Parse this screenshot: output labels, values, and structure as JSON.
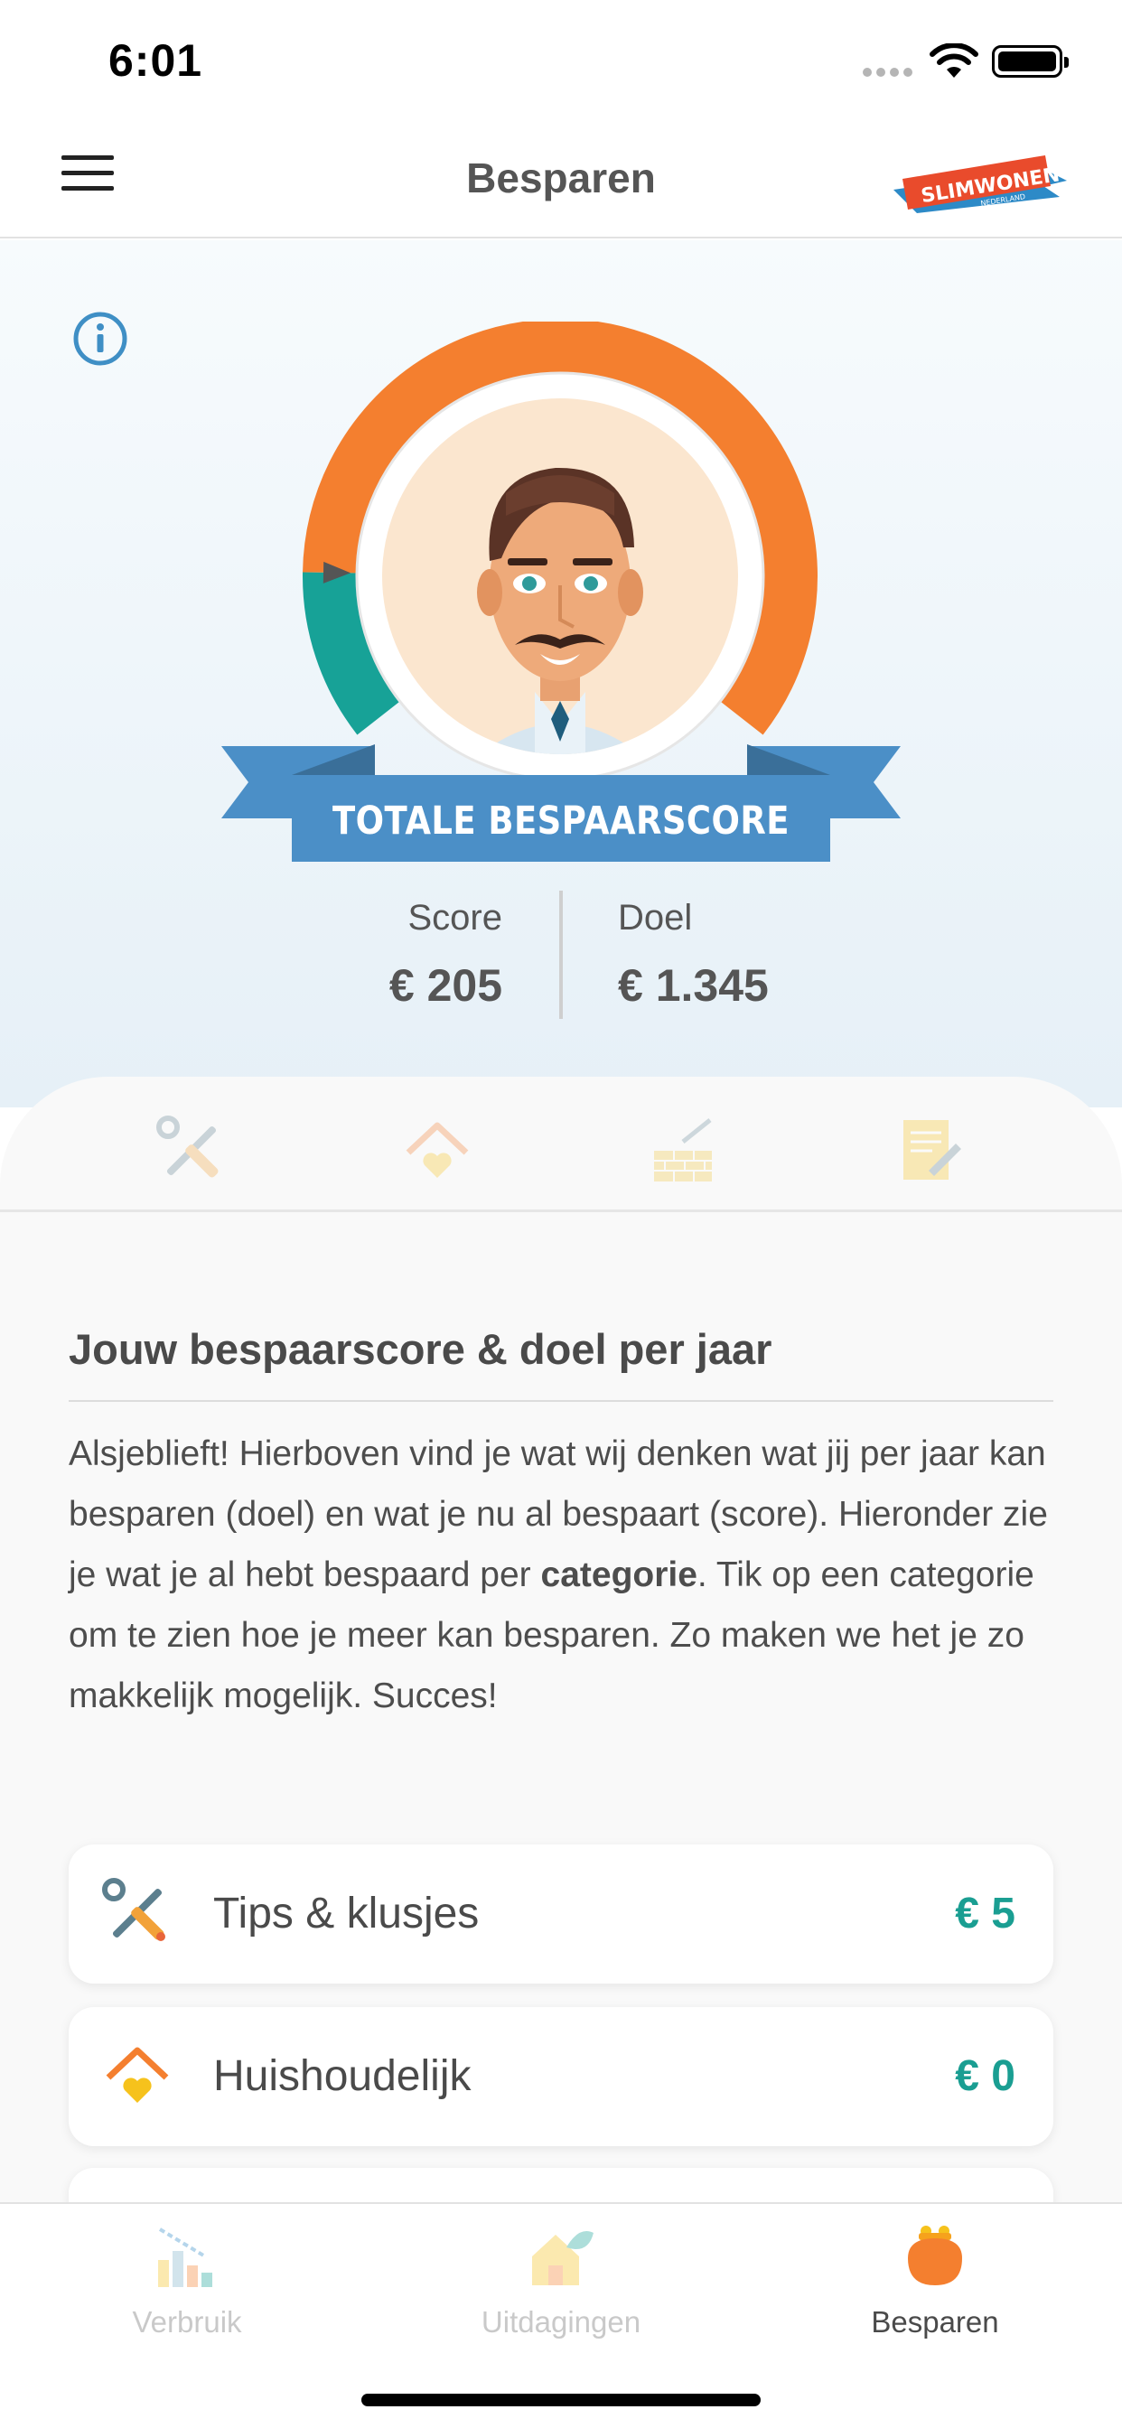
{
  "status_bar": {
    "time": "6:01"
  },
  "nav": {
    "title": "Besparen",
    "logo_text": "SLIMWONEN",
    "logo_subtext": "NEDERLAND"
  },
  "hero": {
    "ribbon_text": "TOTALE BESPAARSCORE",
    "score_label": "Score",
    "score_value": "€ 205",
    "goal_label": "Doel",
    "goal_value": "€ 1.345",
    "progress_fraction": 0.152
  },
  "category_tabs": [
    "tools-icon",
    "house-heart-icon",
    "bricks-icon",
    "document-pen-icon"
  ],
  "section": {
    "title": "Jouw bespaarscore & doel per jaar",
    "text_before_bold": "Alsjeblieft! Hierboven vind je wat wij denken wat jij per jaar kan besparen (doel) en wat je nu al bespaart (score). Hieronder zie je wat je al hebt bespaard per ",
    "text_bold": "categorie",
    "text_after_bold": ". Tik op een categorie om te zien hoe je meer kan besparen. Zo maken we het je zo makkelijk mogelijk. Succes!"
  },
  "categories": [
    {
      "label": "Tips & klusjes",
      "value": "€ 5",
      "icon": "tools-icon"
    },
    {
      "label": "Huishoudelijk",
      "value": "€ 0",
      "icon": "house-heart-icon"
    }
  ],
  "tabbar": {
    "tabs": [
      {
        "label": "Verbruik",
        "icon": "chart-icon",
        "active": false
      },
      {
        "label": "Uitdagingen",
        "icon": "house-leaf-icon",
        "active": false
      },
      {
        "label": "Besparen",
        "icon": "purse-icon",
        "active": true
      }
    ]
  },
  "colors": {
    "accent_orange": "#f47f2f",
    "accent_teal": "#17a297",
    "ribbon_blue": "#4b8fc7",
    "value_green": "#1a9e92"
  }
}
